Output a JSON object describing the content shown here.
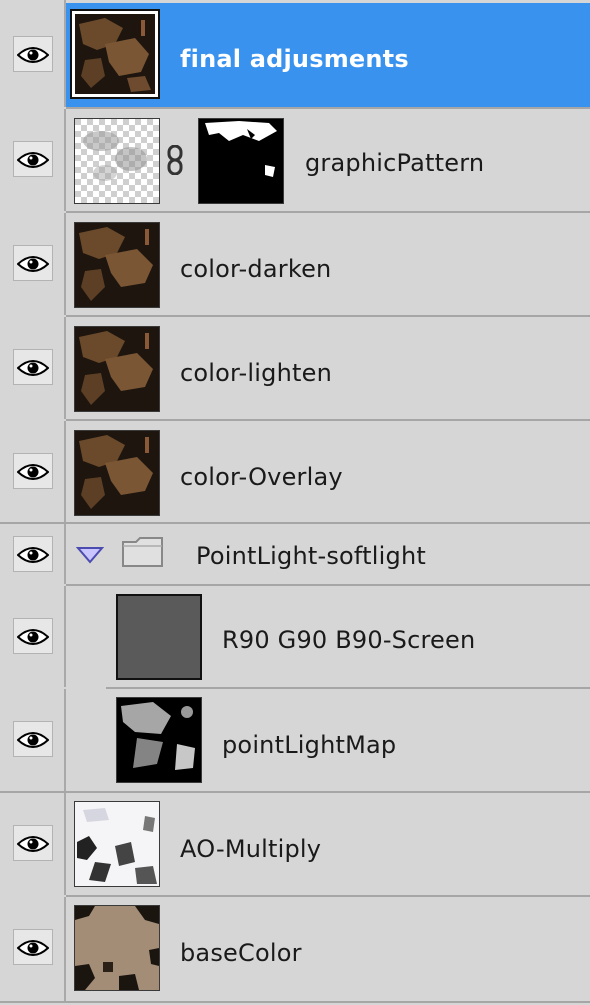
{
  "layers": [
    {
      "name": "final adjusments",
      "selected": true,
      "thumbnail": "texture-dark"
    },
    {
      "name": "graphicPattern",
      "selected": false,
      "thumbnail": "transparent-pattern",
      "mask": true
    },
    {
      "name": "color-darken",
      "selected": false,
      "thumbnail": "texture-dark"
    },
    {
      "name": "color-lighten",
      "selected": false,
      "thumbnail": "texture-dark"
    },
    {
      "name": "color-Overlay",
      "selected": false,
      "thumbnail": "texture-dark"
    }
  ],
  "group": {
    "name": "PointLight-softlight",
    "expanded": true,
    "children": [
      {
        "name": "R90 G90 B90-Screen",
        "thumbnail": "solid-gray",
        "color": "#5a5a5a"
      },
      {
        "name": "pointLightMap",
        "thumbnail": "light-map"
      }
    ]
  },
  "bottom_layers": [
    {
      "name": "AO-Multiply",
      "thumbnail": "ao-map"
    },
    {
      "name": "baseColor",
      "thumbnail": "base-color"
    }
  ],
  "colors": {
    "panel_bg": "#d6d6d6",
    "selection": "#3a92ef",
    "separator": "#a6a6a6"
  },
  "icons": {
    "visibility": "eye-icon",
    "link": "chain-link-icon",
    "expand": "disclosure-triangle-icon",
    "folder": "folder-icon"
  }
}
